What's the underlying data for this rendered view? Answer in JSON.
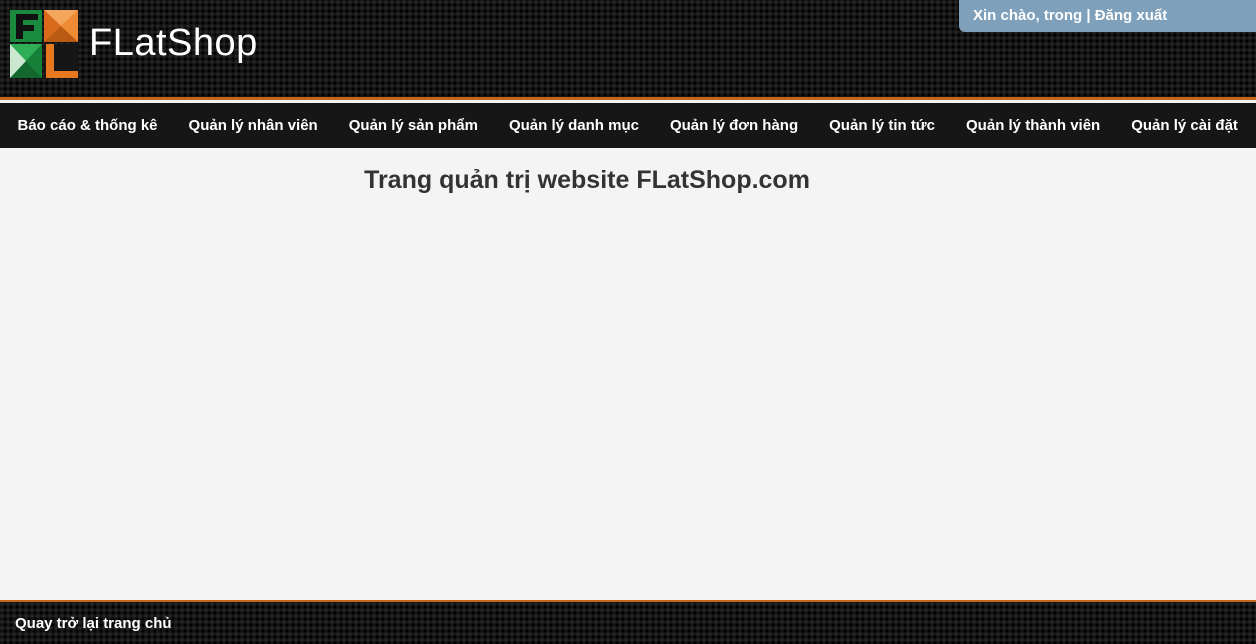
{
  "header": {
    "brand": "FLatShop",
    "user_greeting": "Xin chào, trong",
    "separator": " | ",
    "logout_label": "Đăng xuất"
  },
  "nav": {
    "items": [
      {
        "label": "Báo cáo & thống kê"
      },
      {
        "label": "Quản lý nhân viên"
      },
      {
        "label": "Quản lý sản phẩm"
      },
      {
        "label": "Quản lý danh mục"
      },
      {
        "label": "Quản lý đơn hàng"
      },
      {
        "label": "Quản lý tin tức"
      },
      {
        "label": "Quản lý thành viên"
      },
      {
        "label": "Quản lý cài đặt"
      }
    ]
  },
  "main": {
    "title": "Trang quản trị website FLatShop.com"
  },
  "footer": {
    "back_home_label": "Quay trở lại trang chủ"
  },
  "colors": {
    "accent_orange": "#c7651b",
    "user_box_blue": "#7fa0ba",
    "logo_green": "#1a8a3e",
    "logo_orange": "#e6781f"
  }
}
